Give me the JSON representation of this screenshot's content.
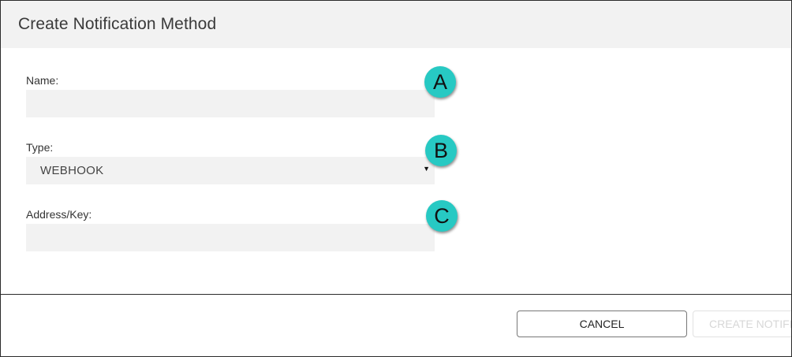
{
  "dialog": {
    "title": "Create Notification Method"
  },
  "form": {
    "name": {
      "label": "Name:",
      "value": ""
    },
    "type": {
      "label": "Type:",
      "value": "WEBHOOK"
    },
    "address": {
      "label": "Address/Key:",
      "value": ""
    }
  },
  "markers": {
    "a": "A",
    "b": "B",
    "c": "C"
  },
  "buttons": {
    "cancel": "CANCEL",
    "create": "CREATE NOTIFICATION METHOD"
  },
  "colors": {
    "marker": "#27c9c3",
    "header_bg": "#f2f2f2",
    "field_bg": "#f2f2f2"
  }
}
